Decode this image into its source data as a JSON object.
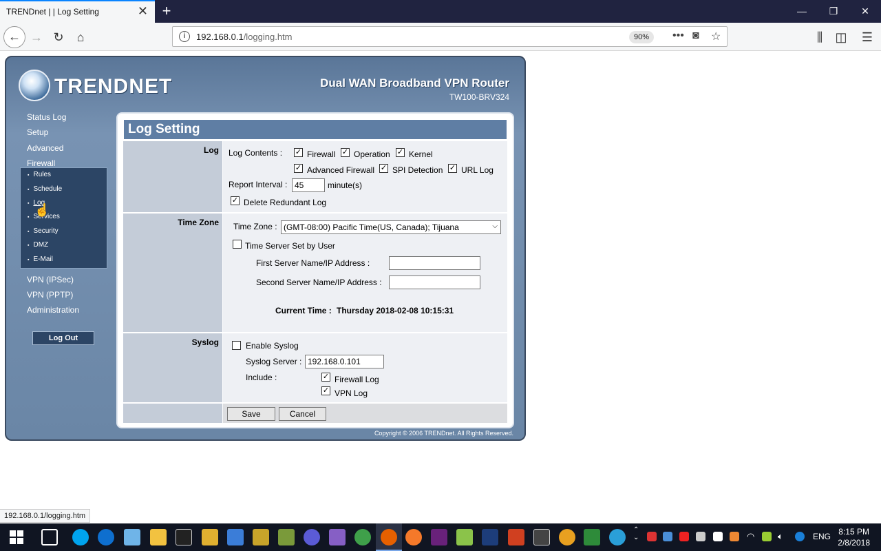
{
  "browser": {
    "tab_title": "TRENDnet | | Log Setting",
    "url_host": "192.168.0.1",
    "url_path": "/logging.htm",
    "zoom": "90%",
    "status_url": "192.168.0.1/logging.htm"
  },
  "header": {
    "logo": "TRENDNET",
    "product_name": "Dual WAN Broadband VPN Router",
    "model": "TW100-BRV324"
  },
  "sidebar": {
    "status_log": "Status Log",
    "setup": "Setup",
    "advanced": "Advanced",
    "firewall": "Firewall",
    "sub_items": [
      "Rules",
      "Schedule",
      "Log",
      "Services",
      "Security",
      "DMZ",
      "E-Mail"
    ],
    "vpn_ipsec": "VPN (IPSec)",
    "vpn_pptp": "VPN (PPTP)",
    "administration": "Administration",
    "logout": "Log Out"
  },
  "panel": {
    "title": "Log Setting",
    "log": {
      "label": "Log",
      "contents_label": "Log Contents :",
      "firewall": {
        "label": "Firewall",
        "checked": true
      },
      "operation": {
        "label": "Operation",
        "checked": true
      },
      "kernel": {
        "label": "Kernel",
        "checked": true
      },
      "advanced_firewall": {
        "label": "Advanced Firewall",
        "checked": true
      },
      "spi_detection": {
        "label": "SPI Detection",
        "checked": true
      },
      "url_log": {
        "label": "URL Log",
        "checked": true
      },
      "report_interval_label": "Report Interval :",
      "report_interval": "45",
      "report_interval_unit": "minute(s)",
      "delete_redundant": {
        "label": "Delete Redundant Log",
        "checked": true
      }
    },
    "time_zone": {
      "label": "Time Zone",
      "tz_label": "Time Zone :",
      "tz_value": "(GMT-08:00) Pacific Time(US, Canada); Tijuana",
      "server_set": {
        "label": "Time Server Set by User",
        "checked": false
      },
      "first_server_label": "First Server Name/IP Address :",
      "first_server": "",
      "second_server_label": "Second Server Name/IP Address :",
      "second_server": "",
      "current_time_label": "Current Time :",
      "current_time": "Thursday 2018-02-08 10:15:31"
    },
    "syslog": {
      "label": "Syslog",
      "enable": {
        "label": "Enable Syslog",
        "checked": false
      },
      "server_label": "Syslog Server :",
      "server": "192.168.0.101",
      "include_label": "Include :",
      "firewall_log": {
        "label": "Firewall Log",
        "checked": true
      },
      "vpn_log": {
        "label": "VPN Log",
        "checked": true
      }
    },
    "save": "Save",
    "cancel": "Cancel"
  },
  "copyright": "Copyright © 2006 TRENDnet. All Rights Reserved.",
  "taskbar": {
    "time": "8:15 PM",
    "date": "2/8/2018",
    "lang": "ENG"
  }
}
